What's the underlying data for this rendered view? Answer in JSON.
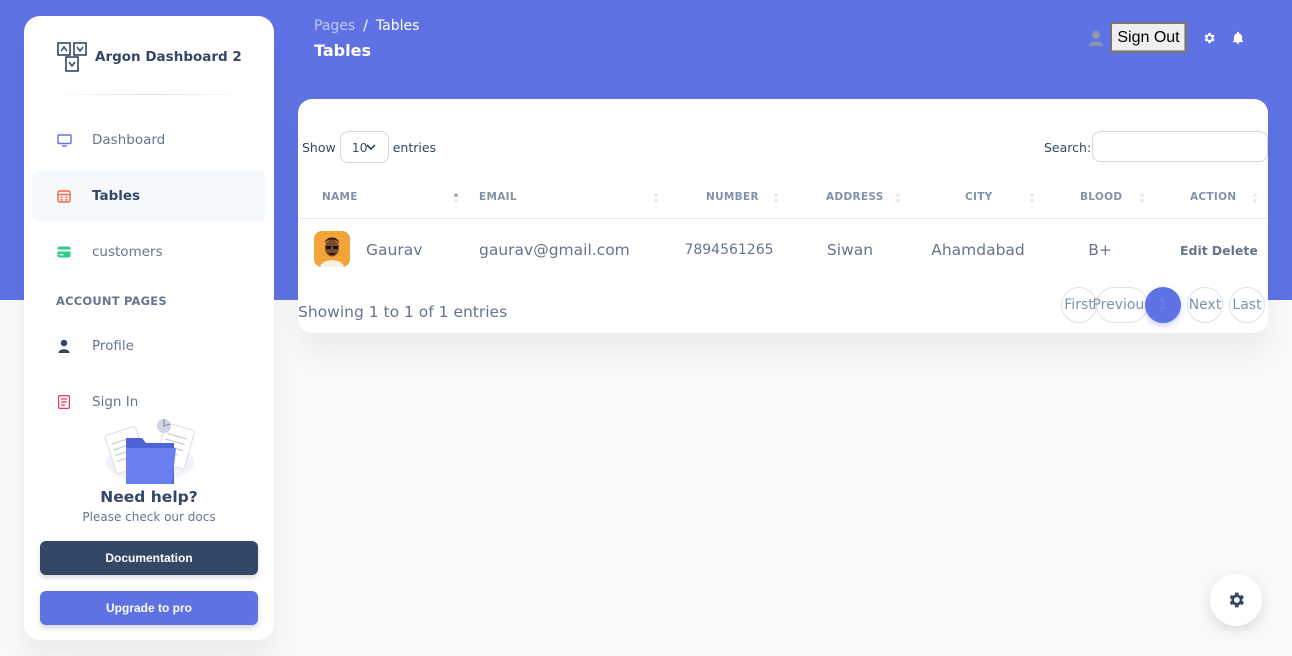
{
  "sidebar": {
    "brand": "Argon Dashboard 2",
    "items": [
      {
        "label": "Dashboard",
        "icon": "monitor-icon",
        "color": "#5e72e4"
      },
      {
        "label": "Tables",
        "icon": "calendar-icon",
        "color": "#fb6340",
        "active": true
      },
      {
        "label": "customers",
        "icon": "credit-card-icon",
        "color": "#2dce89"
      }
    ],
    "section_title": "ACCOUNT PAGES",
    "account_items": [
      {
        "label": "Profile",
        "icon": "user-icon",
        "color": "#344767"
      },
      {
        "label": "Sign In",
        "icon": "document-icon",
        "color": "#f5365c"
      }
    ],
    "help": {
      "title": "Need help?",
      "subtitle": "Please check our docs",
      "doc_button": "Documentation",
      "pro_button": "Upgrade to pro"
    }
  },
  "header": {
    "breadcrumb": {
      "parent": "Pages",
      "separator": "/",
      "current": "Tables"
    },
    "title": "Tables",
    "signout": "Sign Out"
  },
  "table": {
    "show_label": "Show",
    "entries_value": "10",
    "entries_label": "entries",
    "search_label": "Search:",
    "columns": [
      "NAME",
      "EMAIL",
      "NUMBER",
      "ADDRESS",
      "CITY",
      "BLOOD",
      "ACTION"
    ],
    "rows": [
      {
        "name": "Gaurav",
        "email": "gaurav@gmail.com",
        "number": "7894561265",
        "address": "Siwan",
        "city": "Ahamdabad",
        "blood": "B+",
        "edit": "Edit",
        "delete": "Delete"
      }
    ],
    "info": "Showing 1 to 1 of 1 entries",
    "pagination": {
      "first": "First",
      "previous": "Previous",
      "page": "1",
      "next": "Next",
      "last": "Last"
    }
  },
  "colors": {
    "primary": "#5e72e4",
    "dark": "#344767",
    "text": "#67748e"
  }
}
